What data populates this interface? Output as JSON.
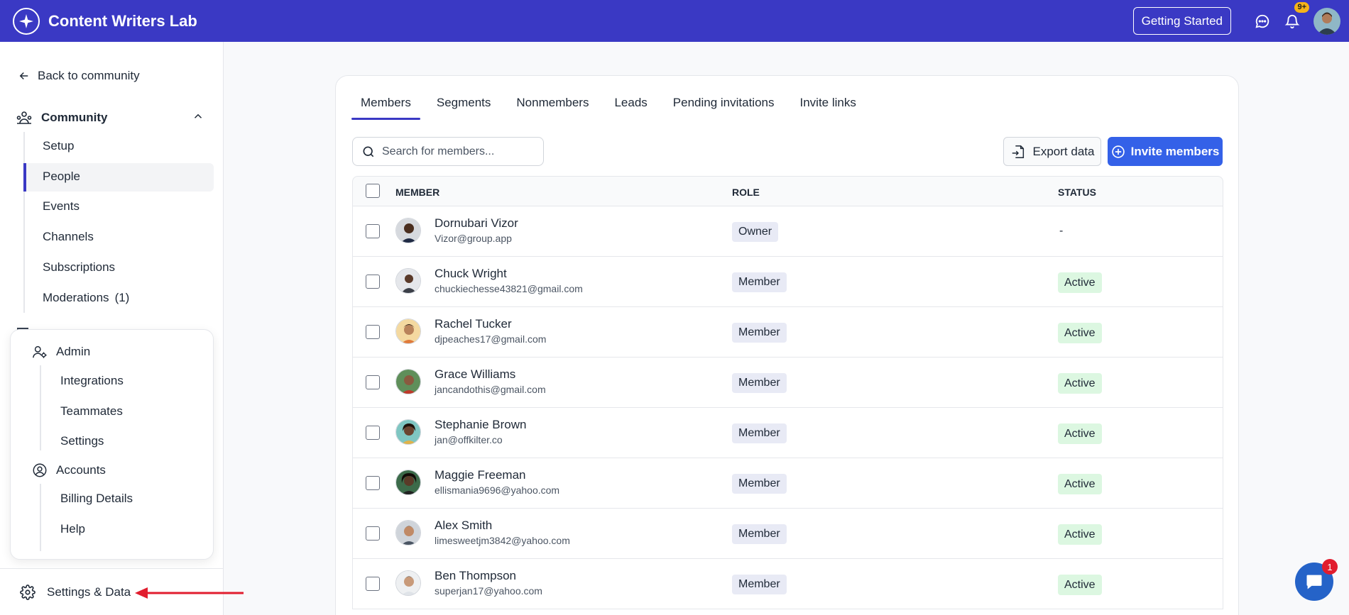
{
  "app": {
    "title": "Content Writers Lab"
  },
  "topbar": {
    "getting_started": "Getting Started",
    "notif_badge": "9+"
  },
  "sidebar": {
    "back": "Back to community",
    "community": {
      "label": "Community",
      "items": [
        "Setup",
        "People",
        "Events",
        "Channels",
        "Subscriptions",
        "Moderations"
      ],
      "moderations_count": "(1)"
    },
    "popup": {
      "admin_label": "Admin",
      "admin_items": [
        "Integrations",
        "Teammates",
        "Settings"
      ],
      "accounts_label": "Accounts",
      "accounts_items": [
        "Billing Details",
        "Help"
      ]
    },
    "settings_data": "Settings & Data"
  },
  "main": {
    "tabs": [
      "Members",
      "Segments",
      "Nonmembers",
      "Leads",
      "Pending invitations",
      "Invite links"
    ],
    "active_tab": "Members",
    "search_placeholder": "Search for members...",
    "export_label": "Export data",
    "invite_label": "Invite members",
    "columns": {
      "member": "MEMBER",
      "role": "ROLE",
      "status": "STATUS"
    },
    "rows": [
      {
        "name": "Dornubari Vizor",
        "email": "Vizor@group.app",
        "role": "Owner",
        "status": "-"
      },
      {
        "name": "Chuck Wright",
        "email": "chuckiechesse43821@gmail.com",
        "role": "Member",
        "status": "Active"
      },
      {
        "name": "Rachel Tucker",
        "email": "djpeaches17@gmail.com",
        "role": "Member",
        "status": "Active"
      },
      {
        "name": "Grace Williams",
        "email": "jancandothis@gmail.com",
        "role": "Member",
        "status": "Active"
      },
      {
        "name": "Stephanie Brown",
        "email": "jan@offkilter.co",
        "role": "Member",
        "status": "Active"
      },
      {
        "name": "Maggie Freeman",
        "email": "ellismania9696@yahoo.com",
        "role": "Member",
        "status": "Active"
      },
      {
        "name": "Alex Smith",
        "email": "limesweetjm3842@yahoo.com",
        "role": "Member",
        "status": "Active"
      },
      {
        "name": "Ben Thompson",
        "email": "superjan17@yahoo.com",
        "role": "Member",
        "status": "Active"
      }
    ]
  },
  "chat": {
    "badge": "1"
  },
  "colors": {
    "brand": "#3a39c4",
    "primary_button": "#3461e8",
    "active_badge": "#dcf7e1",
    "role_badge": "#e8eaf5",
    "annotation_arrow": "#e11d2e"
  }
}
